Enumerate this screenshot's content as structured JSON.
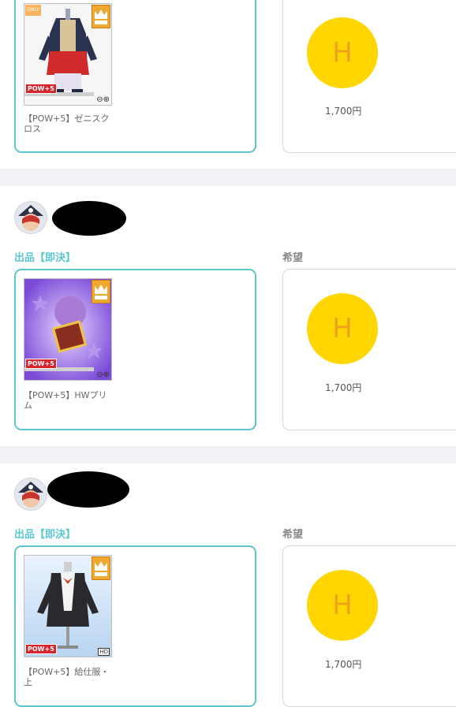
{
  "listings": [
    {
      "offer_label": "",
      "want_label": "",
      "item": {
        "name": "【POW+5】ゼニスクロス",
        "pow_badge": "POW+5",
        "only_badge": "ONLY",
        "zoom_icon": "magnify-zoom-icon"
      },
      "want": {
        "coin_letter": "H",
        "price": "1,700円"
      }
    },
    {
      "offer_label": "出品【即決】",
      "want_label": "希望",
      "item": {
        "name": "【POW+5】HWプリム",
        "pow_badge": "POW+5",
        "zoom_icon": "magnify-zoom-icon"
      },
      "want": {
        "coin_letter": "H",
        "price": "1,700円"
      }
    },
    {
      "offer_label": "出品【即決】",
      "want_label": "希望",
      "item": {
        "name": "【POW+5】給仕服・上",
        "pow_badge": "POW+5",
        "hd_badge": "HD"
      },
      "want": {
        "coin_letter": "H",
        "price": "1,700円"
      }
    }
  ],
  "colors": {
    "accent": "#5ac8cf",
    "coin": "#ffd600",
    "coin_letter": "#f1a21c",
    "pow": "#d8242c"
  }
}
